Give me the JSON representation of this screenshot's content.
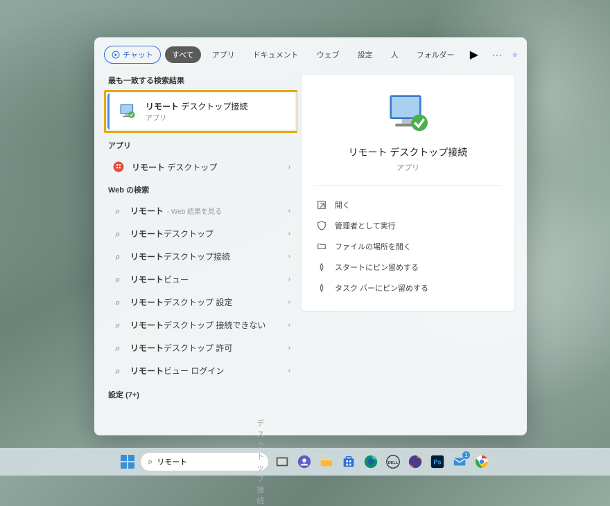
{
  "filters": {
    "chat": "チャット",
    "all": "すべて",
    "apps": "アプリ",
    "documents": "ドキュメント",
    "web": "ウェブ",
    "settings": "設定",
    "people": "人",
    "folder": "フォルダー"
  },
  "section_best_match": "最も一致する検索結果",
  "best_match": {
    "title_bold": "リモート",
    "title_rest": " デスクトップ接続",
    "subtitle": "アプリ"
  },
  "section_apps": "アプリ",
  "app_result": {
    "title_bold": "リモート",
    "title_rest": " デスクトップ"
  },
  "section_web": "Web の検索",
  "web_results": [
    {
      "bold": "リモート",
      "rest": "",
      "suffix": " - Web 結果を見る"
    },
    {
      "bold": "リモート",
      "rest": "デスクトップ"
    },
    {
      "bold": "リモート",
      "rest": "デスクトップ接続"
    },
    {
      "bold": "リモート",
      "rest": "ビュー"
    },
    {
      "bold": "リモート",
      "rest": "デスクトップ 設定"
    },
    {
      "bold": "リモート",
      "rest": "デスクトップ 接続できない"
    },
    {
      "bold": "リモート",
      "rest": "デスクトップ 許可"
    },
    {
      "bold": "リモート",
      "rest": "ビュー ログイン"
    }
  ],
  "settings_more": "設定 (7+)",
  "preview": {
    "title": "リモート デスクトップ接続",
    "subtitle": "アプリ"
  },
  "actions": {
    "open": "開く",
    "run_admin": "管理者として実行",
    "open_location": "ファイルの場所を開く",
    "pin_start": "スタートにピン留めする",
    "pin_taskbar": "タスク バーにピン留めする"
  },
  "taskbar": {
    "search_value": "リモート",
    "search_placeholder_rest": "デスクトップ接続",
    "mail_badge": "1"
  }
}
